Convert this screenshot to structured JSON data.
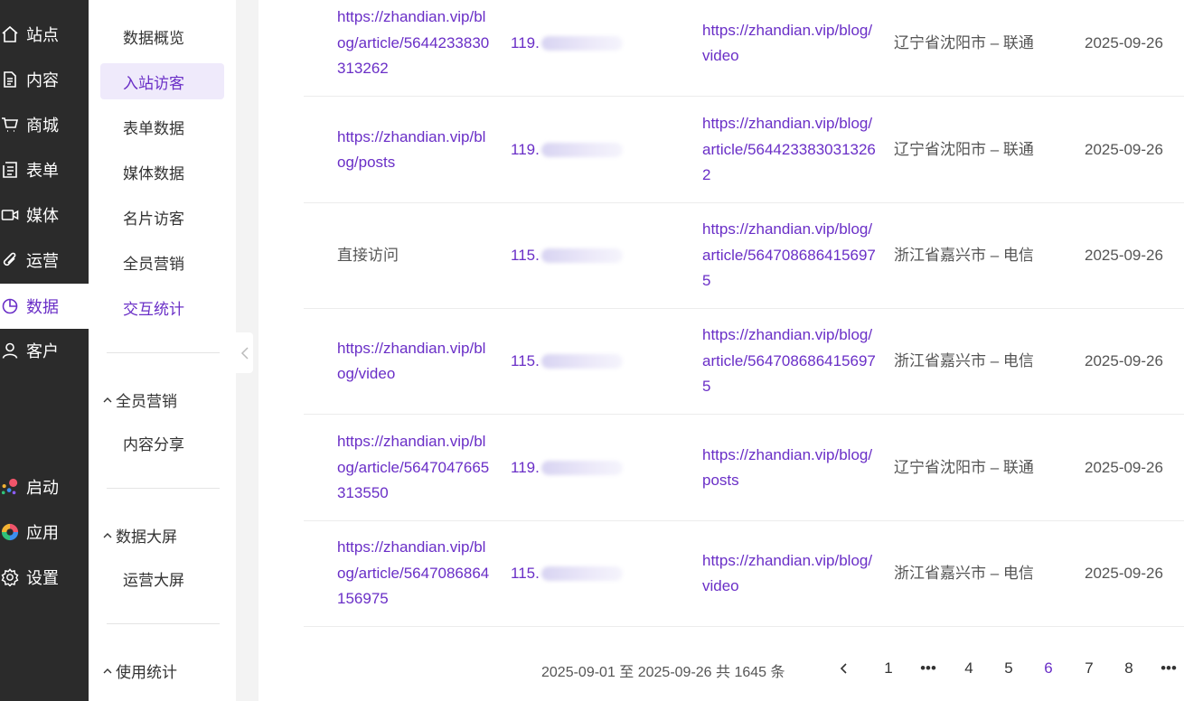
{
  "rail": {
    "items": [
      {
        "label": "站点",
        "icon": "home-icon"
      },
      {
        "label": "内容",
        "icon": "document-icon"
      },
      {
        "label": "商城",
        "icon": "cart-icon"
      },
      {
        "label": "表单",
        "icon": "form-icon"
      },
      {
        "label": "媒体",
        "icon": "video-icon"
      },
      {
        "label": "运营",
        "icon": "paperclip-icon"
      },
      {
        "label": "数据",
        "icon": "pie-chart-icon",
        "active": true
      },
      {
        "label": "客户",
        "icon": "user-icon"
      }
    ],
    "bottom": [
      {
        "label": "启动",
        "icon": "launch-dots-icon"
      },
      {
        "label": "应用",
        "icon": "apps-ring-icon"
      },
      {
        "label": "设置",
        "icon": "gear-icon"
      }
    ]
  },
  "submenu": {
    "items": [
      "数据概览",
      "入站访客",
      "表单数据",
      "媒体数据",
      "名片访客",
      "全员营销",
      "交互统计"
    ],
    "groups": [
      {
        "label": "全员营销",
        "children": [
          "内容分享"
        ]
      },
      {
        "label": "数据大屏",
        "children": [
          "运营大屏"
        ]
      },
      {
        "label": "使用统计",
        "children": []
      }
    ]
  },
  "table": {
    "rows": [
      {
        "source": "https://zhandian.vip/blog/article/5644233830313262",
        "source_is_link": true,
        "ip": "119.",
        "landing": "https://zhandian.vip/blog/video",
        "location": "辽宁省沈阳市 – 联通",
        "date": "2025-09-26"
      },
      {
        "source": "https://zhandian.vip/blog/posts",
        "source_is_link": true,
        "ip": "119.",
        "landing": "https://zhandian.vip/blog/article/5644233830313262",
        "location": "辽宁省沈阳市 – 联通",
        "date": "2025-09-26"
      },
      {
        "source": "直接访问",
        "source_is_link": false,
        "ip": "115.",
        "landing": "https://zhandian.vip/blog/article/5647086864156975",
        "location": "浙江省嘉兴市 – 电信",
        "date": "2025-09-26"
      },
      {
        "source": "https://zhandian.vip/blog/video",
        "source_is_link": true,
        "ip": "115.",
        "landing": "https://zhandian.vip/blog/article/5647086864156975",
        "location": "浙江省嘉兴市 – 电信",
        "date": "2025-09-26"
      },
      {
        "source": "https://zhandian.vip/blog/article/5647047665313550",
        "source_is_link": true,
        "ip": "119.",
        "landing": "https://zhandian.vip/blog/posts",
        "location": "辽宁省沈阳市 – 联通",
        "date": "2025-09-26"
      },
      {
        "source": "https://zhandian.vip/blog/article/5647086864156975",
        "source_is_link": true,
        "ip": "115.",
        "landing": "https://zhandian.vip/blog/video",
        "location": "浙江省嘉兴市 – 电信",
        "date": "2025-09-26"
      }
    ]
  },
  "pagination": {
    "range_text": "2025-09-01 至 2025-09-26 共 1645 条",
    "pages": [
      "1",
      "•••",
      "4",
      "5",
      "6",
      "7",
      "8",
      "•••"
    ],
    "current": "6"
  },
  "colors": {
    "accent": "#6a2fc7",
    "rail_bg": "#2b2b2b",
    "active_sub_bg": "#efeafb"
  }
}
